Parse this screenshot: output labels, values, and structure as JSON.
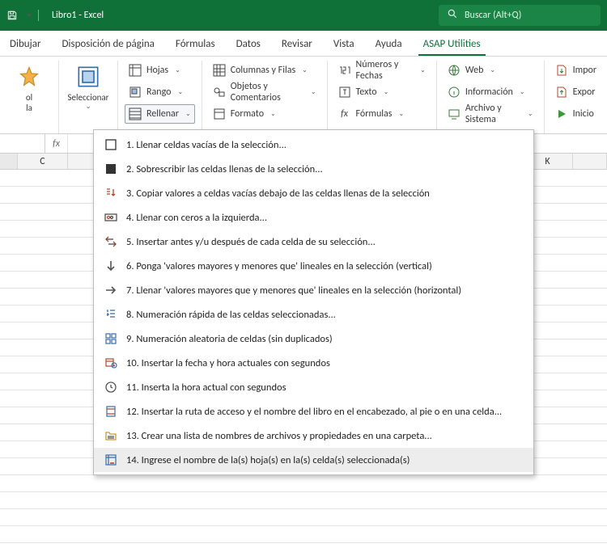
{
  "title": "Libro1 - Excel",
  "search_placeholder": "Buscar (Alt+Q)",
  "tabs": [
    "Dibujar",
    "Disposición de página",
    "Fórmulas",
    "Datos",
    "Revisar",
    "Vista",
    "Ayuda",
    "ASAP Utilities"
  ],
  "active_tab": 7,
  "ribbon": {
    "big1_line1": "ol",
    "big1_line2": "la",
    "big2": "Seleccionar",
    "col1": [
      "Hojas",
      "Rango",
      "Rellenar"
    ],
    "col2": [
      "Columnas y Filas",
      "Objetos y Comentarios",
      "Formato"
    ],
    "col3": [
      "Números y Fechas",
      "Texto",
      "Fórmulas"
    ],
    "col4": [
      "Web",
      "Información",
      "Archivo y Sistema"
    ],
    "col5": [
      "Impor",
      "Expor",
      "Inicio"
    ]
  },
  "fx": "fx",
  "col_c": "C",
  "col_k": "K",
  "menu": [
    "1. Llenar celdas vacías de la selección...",
    "2. Sobrescribir las celdas llenas de la selección...",
    "3. Copiar valores a celdas vacías debajo de las celdas llenas de la selección",
    "4. Llenar con ceros a la izquierda...",
    "5. Insertar antes y/u después de cada celda de su selección...",
    "6. Ponga 'valores mayores y menores que' lineales en la selección (vertical)",
    "7. Llenar 'valores mayores que y menores que' lineales en la selección (horizontal)",
    "8. Numeración rápida de las celdas seleccionadas...",
    "9. Numeración aleatoria de celdas (sin duplicados)",
    "10. Insertar la fecha y hora actuales con segundos",
    "11. Inserta la hora actual con segundos",
    "12. Insertar la ruta de acceso y el nombre del libro en el encabezado, al pie o en una celda...",
    "13. Crear una lista de nombres de archivos y propiedades en una carpeta...",
    "14. Ingrese el nombre de la(s) hoja(s) en la(s) celda(s) seleccionada(s)"
  ]
}
